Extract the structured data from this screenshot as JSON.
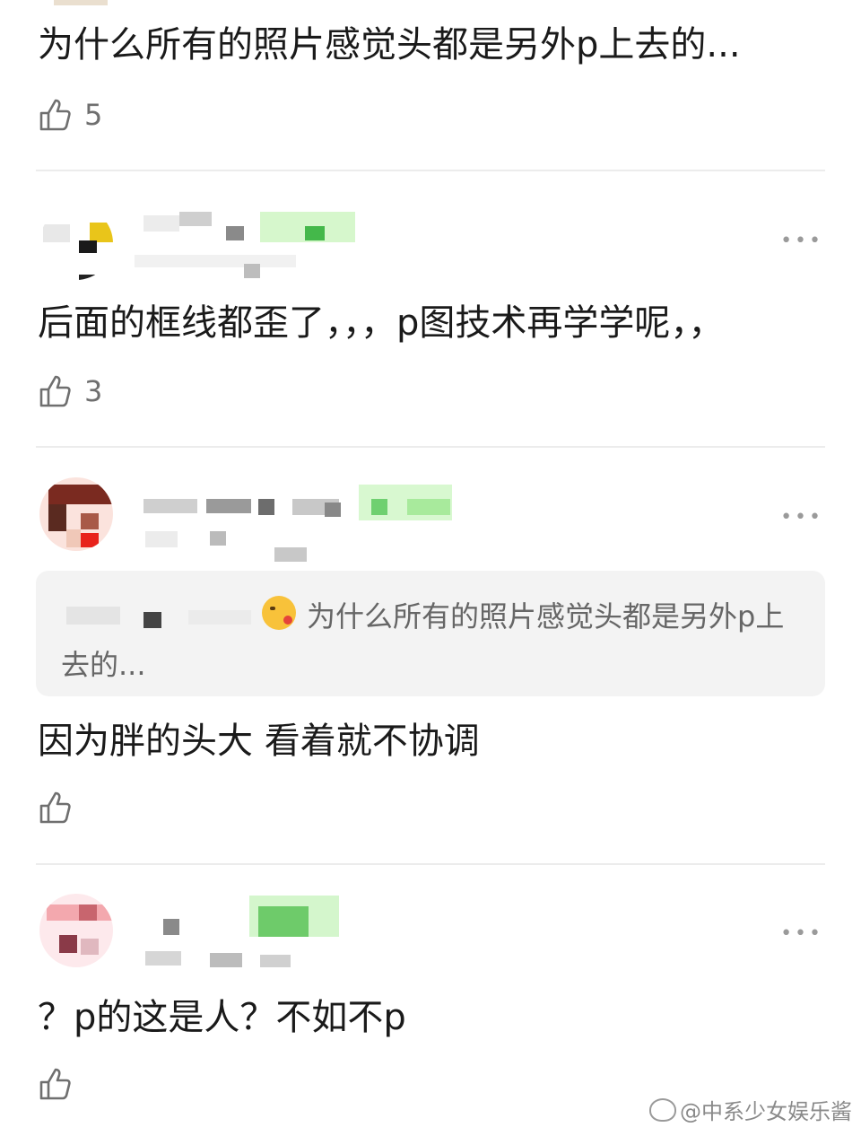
{
  "comments": [
    {
      "text": "为什么所有的照片感觉头都是另外p上去的...",
      "likes": "5"
    },
    {
      "text": "后面的框线都歪了，，，p图技术再学学呢，，",
      "likes": "3"
    },
    {
      "quote": {
        "text_line1": "为什么所有的照片感觉头都是另外p上",
        "text_line2": "去的..."
      },
      "text": "因为胖的头大   看着就不协调",
      "likes": ""
    },
    {
      "text": "？p的这是人？不如不p",
      "likes": ""
    }
  ],
  "more_label": "•••",
  "watermark": "@中系少女娱乐酱",
  "icons": {
    "like": "thumbs-up-icon",
    "more": "more-dots-icon",
    "weibo": "weibo-logo-icon"
  },
  "colors": {
    "text": "#1a1a1a",
    "count": "#6f6f6f",
    "divider": "#ececec",
    "quote_bg": "#f3f3f3"
  }
}
